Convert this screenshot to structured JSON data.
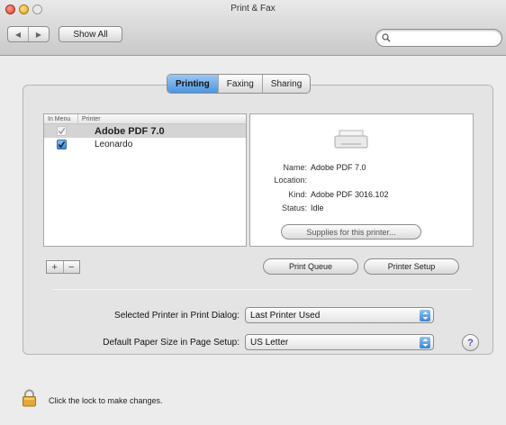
{
  "window": {
    "title": "Print & Fax"
  },
  "toolbar": {
    "back_icon": "back-arrow-icon",
    "forward_icon": "forward-arrow-icon",
    "show_all_label": "Show All",
    "search": {
      "value": "",
      "placeholder": ""
    }
  },
  "tabs": [
    {
      "label": "Printing",
      "active": true
    },
    {
      "label": "Faxing",
      "active": false
    },
    {
      "label": "Sharing",
      "active": false
    }
  ],
  "printer_list": {
    "col_in_menu": "In Menu",
    "col_printer": "Printer",
    "items": [
      {
        "name": "Adobe PDF 7.0",
        "in_menu": true,
        "selected": true
      },
      {
        "name": "Leonardo",
        "in_menu": true,
        "selected": false
      }
    ]
  },
  "printer_info": {
    "name_label": "Name:",
    "name_value": "Adobe PDF 7.0",
    "location_label": "Location:",
    "location_value": "",
    "kind_label": "Kind:",
    "kind_value": "Adobe PDF 3016.102",
    "status_label": "Status:",
    "status_value": "Idle",
    "supplies_label": "Supplies for this printer..."
  },
  "list_buttons": {
    "add_label": "+",
    "remove_label": "−"
  },
  "print_queue_label": "Print Queue",
  "printer_setup_label": "Printer Setup",
  "selected_printer": {
    "label": "Selected Printer in Print Dialog:",
    "value": "Last Printer Used"
  },
  "default_paper": {
    "label": "Default Paper Size in Page Setup:",
    "value": "US Letter"
  },
  "help_label": "?",
  "lock_text": "Click the lock to make changes.",
  "colors": {
    "accent": "#4c95e0",
    "close": "#d8412f",
    "minimize": "#e0a21a",
    "lock": "#e3a935"
  }
}
